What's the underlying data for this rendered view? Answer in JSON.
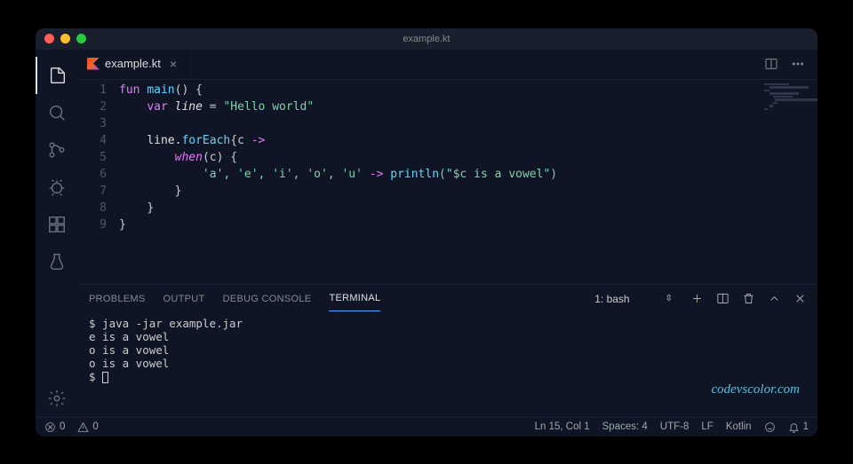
{
  "window": {
    "title": "example.kt"
  },
  "tab": {
    "filename": "example.kt"
  },
  "gutter": {
    "l1": "1",
    "l2": "2",
    "l3": "3",
    "l4": "4",
    "l5": "5",
    "l6": "6",
    "l7": "7",
    "l8": "8",
    "l9": "9"
  },
  "code": {
    "kw_fun": "fun",
    "fn_main": "main",
    "parens_open": "() {",
    "kw_var": "var",
    "var_line": " line ",
    "eq": "= ",
    "str_hello": "\"Hello world\"",
    "line4_a": "line.",
    "fn_foreach": "forEach",
    "line4_b": "{c ",
    "arrow": "->",
    "kw_when": "when",
    "when_open": "(c) {",
    "chars": "'a', 'e', 'i', 'o', 'u'",
    "arrow2": " -> ",
    "fn_println": "println",
    "println_arg": "(\"$c is a vowel\")",
    "brace_close_7": "}",
    "brace_close_8": "}",
    "brace_close_9": "}"
  },
  "panel": {
    "tab_problems": "PROBLEMS",
    "tab_output": "OUTPUT",
    "tab_debug": "DEBUG CONSOLE",
    "tab_terminal": "TERMINAL",
    "shell_label": "1: bash"
  },
  "terminal": {
    "line1": "$ java -jar example.jar",
    "line2": "e is a vowel",
    "line3": "o is a vowel",
    "line4": "o is a vowel",
    "prompt": "$ "
  },
  "status": {
    "errors": "0",
    "warnings": "0",
    "cursor": "Ln 15, Col 1",
    "spaces": "Spaces: 4",
    "encoding": "UTF-8",
    "eol": "LF",
    "language": "Kotlin",
    "bell": "1"
  },
  "watermark": "codevscolor.com"
}
